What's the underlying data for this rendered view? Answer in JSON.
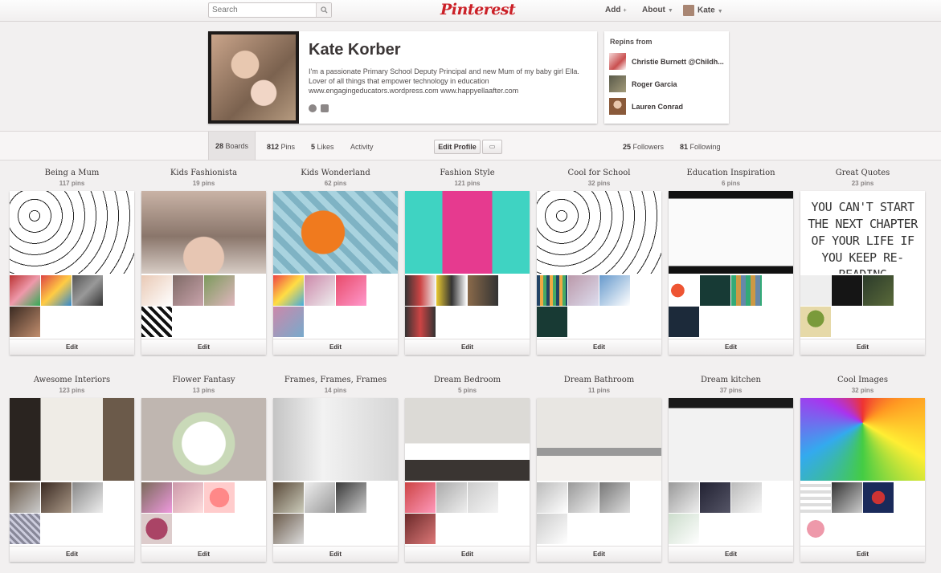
{
  "topbar": {
    "search_placeholder": "Search",
    "logo": "Pinterest",
    "nav_add": "Add",
    "nav_about": "About",
    "nav_user": "Kate"
  },
  "profile": {
    "name": "Kate Korber",
    "bio": "I'm a passionate Primary School Deputy Principal and new Mum of my baby girl Ella. Lover of all things that empower technology in education www.engagingeducators.wordpress.com www.happyellaafter.com"
  },
  "repins": {
    "title": "Repins from",
    "people": [
      {
        "name": "Christie Burnett @Childh..."
      },
      {
        "name": "Roger Garcia"
      },
      {
        "name": "Lauren Conrad"
      }
    ]
  },
  "stats": {
    "boards_count": "28",
    "boards_label": "Boards",
    "pins_count": "812",
    "pins_label": "Pins",
    "likes_count": "5",
    "likes_label": "Likes",
    "activity_label": "Activity",
    "edit_profile": "Edit Profile",
    "followers_count": "25",
    "followers_label": "Followers",
    "following_count": "81",
    "following_label": "Following"
  },
  "boards": [
    {
      "title": "Being a Mum",
      "pins": "117 pins",
      "edit": "Edit"
    },
    {
      "title": "Kids Fashionista",
      "pins": "19 pins",
      "edit": "Edit"
    },
    {
      "title": "Kids Wonderland",
      "pins": "62 pins",
      "edit": "Edit"
    },
    {
      "title": "Fashion Style",
      "pins": "121 pins",
      "edit": "Edit"
    },
    {
      "title": "Cool for School",
      "pins": "32 pins",
      "edit": "Edit"
    },
    {
      "title": "Education Inspiration",
      "pins": "6 pins",
      "edit": "Edit"
    },
    {
      "title": "Great Quotes",
      "pins": "23 pins",
      "edit": "Edit",
      "quote": "YOU CAN'T START THE NEXT CHAPTER OF YOUR LIFE IF YOU KEEP RE-READING"
    },
    {
      "title": "Awesome Interiors",
      "pins": "123 pins",
      "edit": "Edit"
    },
    {
      "title": "Flower Fantasy",
      "pins": "13 pins",
      "edit": "Edit"
    },
    {
      "title": "Frames, Frames, Frames",
      "pins": "14 pins",
      "edit": "Edit"
    },
    {
      "title": "Dream Bedroom",
      "pins": "5 pins",
      "edit": "Edit"
    },
    {
      "title": "Dream Bathroom",
      "pins": "11 pins",
      "edit": "Edit"
    },
    {
      "title": "Dream kitchen",
      "pins": "37 pins",
      "edit": "Edit"
    },
    {
      "title": "Cool Images",
      "pins": "32 pins",
      "edit": "Edit"
    }
  ],
  "colors": {
    "brand": "#cb2027",
    "background": "#f2f0f0"
  }
}
